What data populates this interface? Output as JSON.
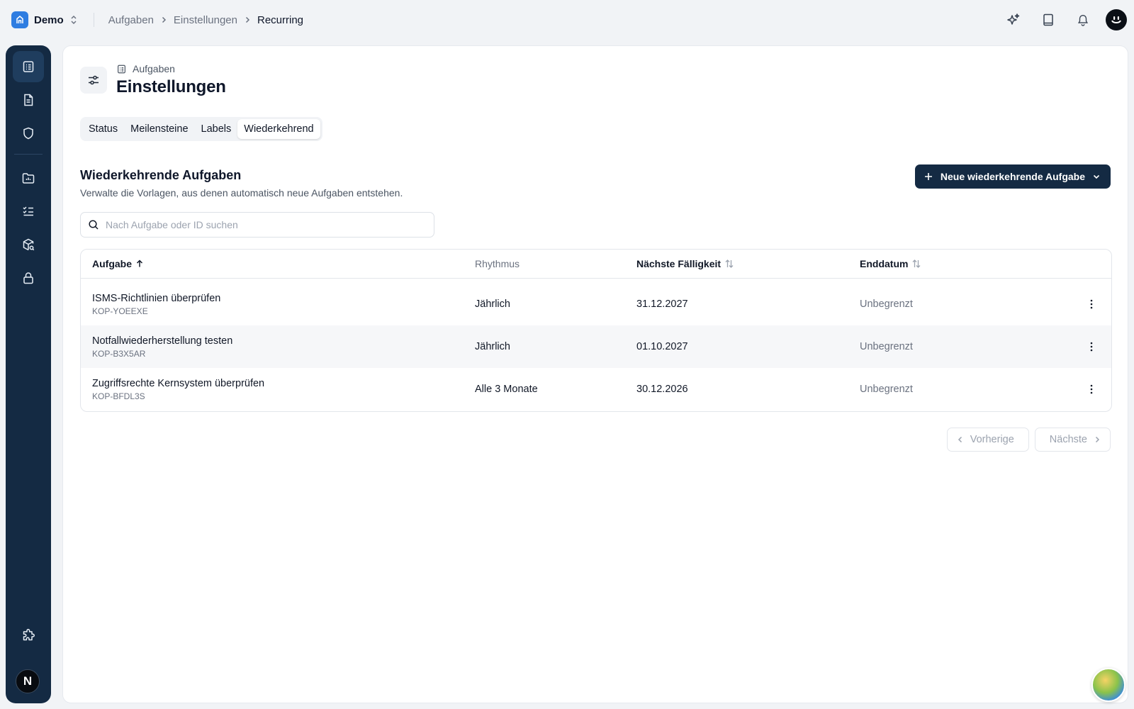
{
  "app": {
    "workspace_name": "Demo"
  },
  "breadcrumb": [
    "Aufgaben",
    "Einstellungen",
    "Recurring"
  ],
  "header": {
    "section_label": "Aufgaben",
    "title": "Einstellungen"
  },
  "tabs": [
    {
      "label": "Status",
      "active": false
    },
    {
      "label": "Meilensteine",
      "active": false
    },
    {
      "label": "Labels",
      "active": false
    },
    {
      "label": "Wiederkehrend",
      "active": true
    }
  ],
  "section": {
    "title": "Wiederkehrende Aufgaben",
    "description": "Verwalte die Vorlagen, aus denen automatisch neue Aufgaben entstehen.",
    "new_button_label": "Neue wiederkehrende Aufgabe"
  },
  "search": {
    "placeholder": "Nach Aufgabe oder ID suchen",
    "value": ""
  },
  "table": {
    "columns": {
      "task": "Aufgabe",
      "rhythm": "Rhythmus",
      "next_due": "Nächste Fälligkeit",
      "end_date": "Enddatum"
    },
    "sort": {
      "column": "task",
      "direction": "ascending"
    },
    "rows": [
      {
        "name": "ISMS-Richtlinien überprüfen",
        "id": "KOP-YOEEXE",
        "rhythm": "Jährlich",
        "next_due": "31.12.2027",
        "end_date": "Unbegrenzt"
      },
      {
        "name": "Notfallwiederherstellung testen",
        "id": "KOP-B3X5AR",
        "rhythm": "Jährlich",
        "next_due": "01.10.2027",
        "end_date": "Unbegrenzt"
      },
      {
        "name": "Zugriffsrechte Kernsystem überprüfen",
        "id": "KOP-BFDL3S",
        "rhythm": "Alle 3 Monate",
        "next_due": "30.12.2026",
        "end_date": "Unbegrenzt"
      }
    ]
  },
  "pagination": {
    "prev_label": "Vorherige",
    "next_label": "Nächste"
  },
  "user": {
    "initial": "N"
  },
  "icons": {
    "top": [
      "sparkles-icon",
      "book-icon",
      "bell-icon",
      "user-avatar"
    ],
    "sidebar": [
      "tasks-icon",
      "document-icon",
      "shield-icon",
      "folder-icon",
      "checklist-icon",
      "package-search-icon",
      "lock-icon",
      "puzzle-icon"
    ]
  },
  "colors": {
    "brand": "#2f7de1",
    "sidebar": "#142a43",
    "primary_button": "#142a43"
  }
}
